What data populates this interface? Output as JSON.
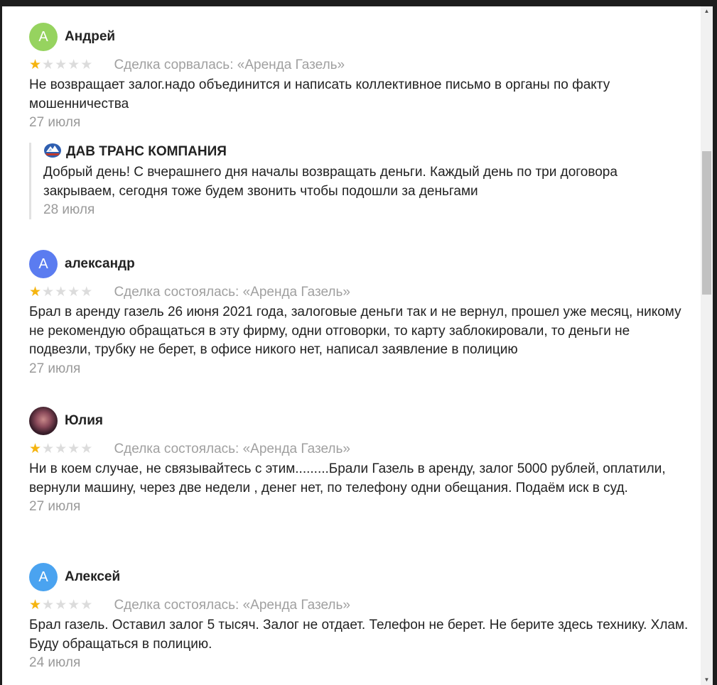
{
  "reviews": [
    {
      "author": "Андрей",
      "avatar_letter": "А",
      "avatar_color": "#96d35f",
      "rating": 1,
      "deal": "Сделка сорвалась: «Аренда Газель»",
      "text": "Не возвращает залог.надо объединится и написать коллективное письмо в органы по факту мошенничества",
      "date": "27 июля",
      "reply": {
        "author": "ДАВ ТРАНС КОМПАНИЯ",
        "text": "Добрый день! С вчерашнего дня началы возвращать деньги. Каждый день по три договора закрываем, сегодня тоже будем звонить чтобы подошли за деньгами",
        "date": "28 июля"
      }
    },
    {
      "author": "александр",
      "avatar_letter": "А",
      "avatar_color": "#5b7cf0",
      "rating": 1,
      "deal": "Сделка состоялась: «Аренда Газель»",
      "text": "Брал в аренду газель 26 июня 2021 года, залоговые деньги так и не вернул, прошел уже месяц, никому не рекомендую обращаться в эту фирму, одни отговорки, то карту заблокировали, то деньги не подвезли, трубку не берет, в офисе никого нет, написал заявление в полицию",
      "date": "27 июля"
    },
    {
      "author": "Юлия",
      "avatar_letter": "",
      "avatar_color": "#6a3a4a",
      "rating": 1,
      "deal": "Сделка состоялась: «Аренда Газель»",
      "text": "Ни в коем случае, не связывайтесь с этим.........Брали Газель в аренду, залог 5000 рублей, оплатили, вернули машину, через две недели , денег нет, по телефону одни обещания. Подаём иск в суд.",
      "date": "27 июля"
    },
    {
      "author": "Алексей",
      "avatar_letter": "А",
      "avatar_color": "#4aa3f0",
      "rating": 1,
      "deal": "Сделка состоялась: «Аренда Газель»",
      "text": "Брал газель. Оставил залог 5 тысяч. Залог не отдает. Телефон не берет. Не берите здесь технику. Хлам. Буду обращаться в полицию.",
      "date": "24 июля"
    }
  ],
  "scrollbar": {
    "up_arrow": "▲",
    "down_arrow": "▼"
  },
  "icons": {
    "star": "★",
    "company_logo": "company-logo-icon"
  }
}
